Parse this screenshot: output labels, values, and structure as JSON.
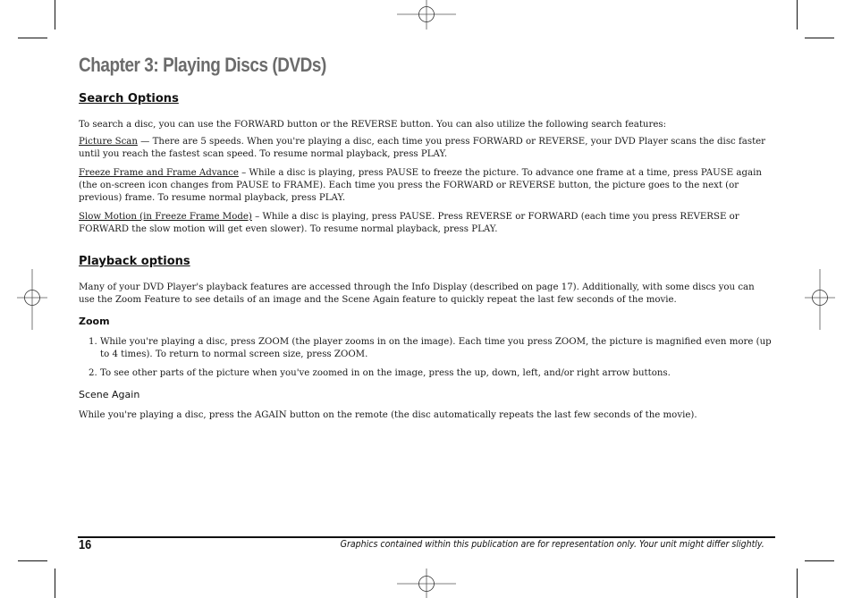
{
  "chapter_title": "Chapter 3: Playing Discs (DVDs)",
  "sections": {
    "search": {
      "heading": "Search Options",
      "intro": "To search a disc, you can use the FORWARD button or the REVERSE button. You can also utilize the following search features:",
      "items": [
        {
          "term": "Picture Scan",
          "separator": " — ",
          "text": "There are 5 speeds. When you're playing a disc, each time you press FORWARD or REVERSE, your DVD Player scans the disc faster until you reach the fastest scan speed. To resume normal playback, press PLAY."
        },
        {
          "term": "Freeze Frame and Frame Advance",
          "separator": " – ",
          "text": "While a disc is playing, press PAUSE to freeze the picture. To advance one frame at a time, press PAUSE again (the on-screen icon changes from PAUSE to FRAME). Each time you press the FORWARD or REVERSE button, the picture goes to the next (or previous) frame. To resume normal playback, press PLAY."
        },
        {
          "term": "Slow Motion (in Freeze Frame Mode)",
          "separator": " – ",
          "text": "While a disc is playing, press PAUSE. Press REVERSE or FORWARD (each time you press REVERSE or FORWARD the slow motion will get even slower). To resume normal playback, press PLAY."
        }
      ]
    },
    "playback": {
      "heading": "Playback options",
      "intro": "Many of your DVD Player's playback features are accessed through the Info Display (described on page 17). Additionally, with some discs you can use the Zoom Feature to see details of an image and the Scene Again feature to quickly repeat the last few seconds of the movie.",
      "zoom": {
        "heading": "Zoom",
        "steps": [
          "1. While you're playing a disc, press ZOOM (the player zooms in on the image). Each time you press ZOOM, the picture is magnified even more (up to 4 times). To return to normal screen size, press ZOOM.",
          "2. To see other parts of the picture when you've zoomed in on the image, press the up, down, left, and/or right arrow buttons."
        ]
      },
      "scene_again": {
        "heading": "Scene Again",
        "text": "While you're playing a disc, press the AGAIN button on the remote (the disc automatically repeats the last few seconds of the movie)."
      }
    }
  },
  "footer": {
    "page_number": "16",
    "note": "Graphics contained within this publication are for representation only. Your unit might differ slightly."
  }
}
